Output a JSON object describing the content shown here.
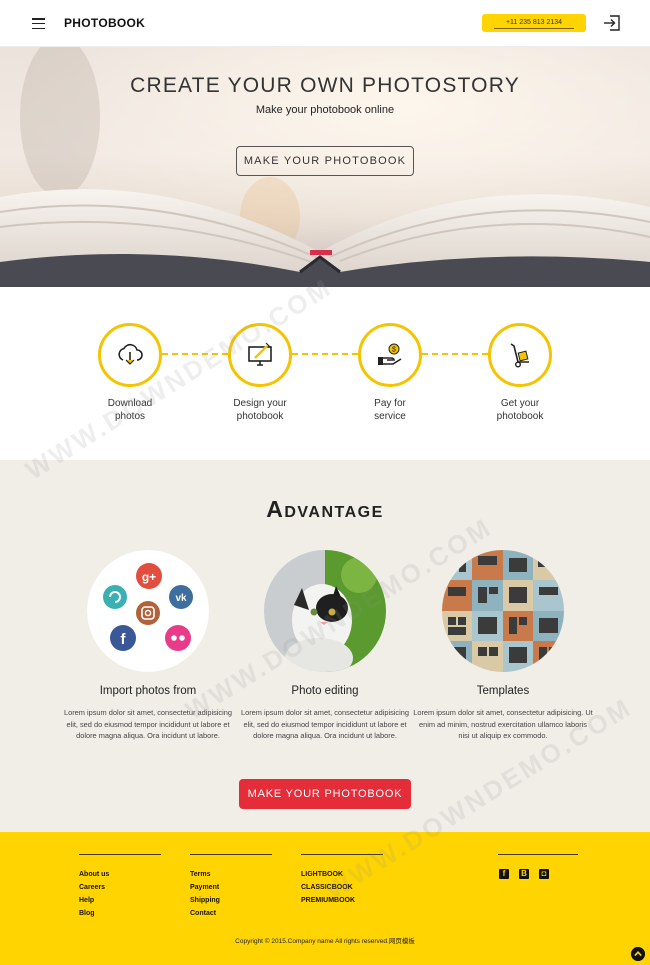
{
  "header": {
    "brand": "PHOTOBOOK",
    "phone": "+11 235 813 2134",
    "menu_icon": "hamburger-icon",
    "login_icon": "sign-in-icon"
  },
  "hero": {
    "title": "CREATE YOUR OWN PHOTOSTORY",
    "subtitle": "Make your photobook online",
    "button": "MAKE YOUR PHOTOBOOK"
  },
  "steps": [
    {
      "line1": "Download",
      "line2": "photos",
      "icon": "cloud-download-icon"
    },
    {
      "line1": "Design your",
      "line2": "photobook",
      "icon": "monitor-design-icon"
    },
    {
      "line1": "Pay for",
      "line2": "service",
      "icon": "hand-coin-icon"
    },
    {
      "line1": "Get your",
      "line2": "photobook",
      "icon": "hand-truck-icon"
    }
  ],
  "advantage": {
    "title": "Advantage",
    "features": [
      {
        "title": "Import photos from",
        "text": "Lorem ipsum dolor sit amet, consectetur adipisicing elit, sed do eiusmod tempor incididunt ut labore et dolore magna aliqua. Ora incidunt ut labore."
      },
      {
        "title": "Photo editing",
        "text": "Lorem ipsum dolor sit amet, consectetur adipisicing elit, sed do eiusmod tempor incididunt ut labore et dolore magna aliqua. Ora incidunt ut labore."
      },
      {
        "title": "Templates",
        "text": "Lorem ipsum dolor sit amet, consectetur adipisicing. Ut enim ad minim, nostrud exercitation ullamco laboris nisi ut aliquip ex commodo."
      }
    ],
    "cta": "MAKE YOUR PHOTOBOOK",
    "social_icons": [
      "google-plus-icon",
      "vk-icon",
      "refresh-icon",
      "instagram-icon",
      "facebook-icon",
      "flickr-icon"
    ]
  },
  "footer": {
    "col1": [
      "About us",
      "Careers",
      "Help",
      "Blog"
    ],
    "col2": [
      "Terms",
      "Payment",
      "Shipping",
      "Contact"
    ],
    "col3": [
      "LIGHTBOOK",
      "CLASSICBOOK",
      "PREMIUMBOOK"
    ],
    "social": [
      "facebook-icon",
      "blogger-icon",
      "instagram-icon"
    ],
    "copyright": "Copyright © 2015.Company name All rights reserved.网页模板",
    "to_top_icon": "arrow-up-icon"
  },
  "watermark": "WWW.DOWNDEMO.COM",
  "colors": {
    "accent": "#ffd400",
    "cta": "#e52d3a",
    "step_ring": "#f5c400",
    "section_bg": "#f1eee8"
  }
}
